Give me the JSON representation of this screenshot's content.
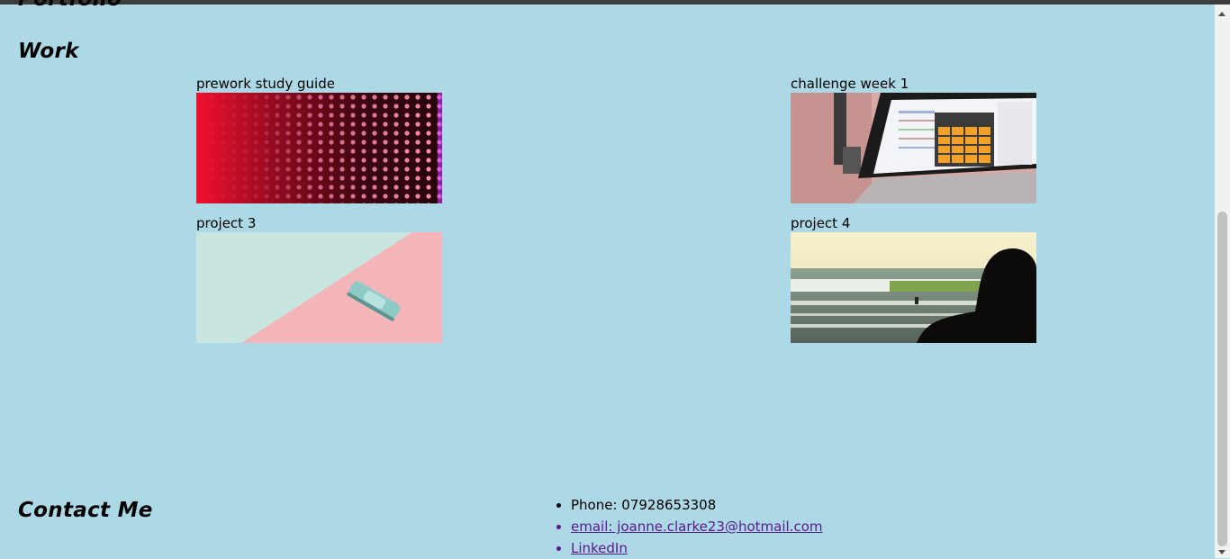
{
  "headings": {
    "portfolio": "Portfolio",
    "work": "Work",
    "contact": "Contact Me"
  },
  "projects": [
    {
      "title": "prework study guide",
      "image": "led-wall-photo"
    },
    {
      "title": "challenge week 1",
      "image": "laptop-calculator-photo"
    },
    {
      "title": "project 3",
      "image": "toy-car-photo"
    },
    {
      "title": "project 4",
      "image": "surfer-photo"
    }
  ],
  "contact": {
    "phone": "Phone: 07928653308",
    "email": "email: joanne.clarke23@hotmail.com",
    "linkedin": "LinkedIn"
  },
  "colors": {
    "background": "#add8e6",
    "link": "#551a8b"
  }
}
